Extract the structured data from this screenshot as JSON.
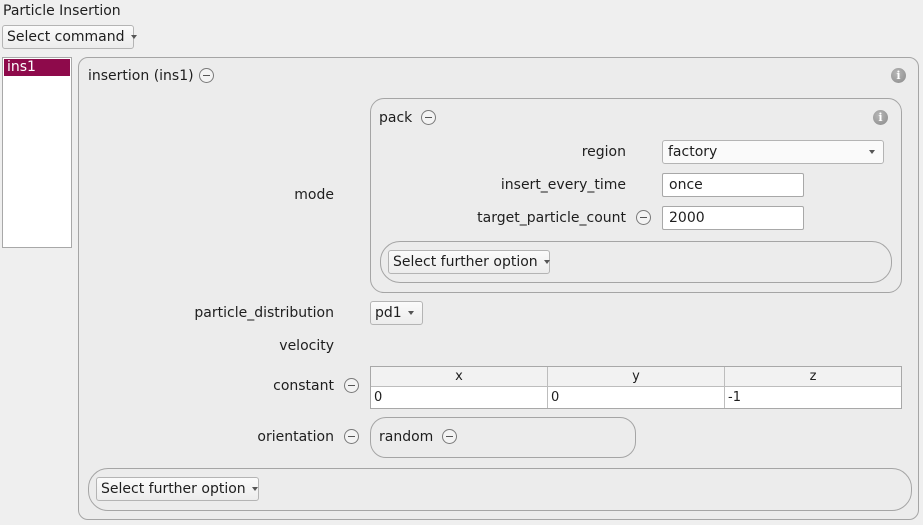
{
  "title": "Particle Insertion",
  "command_select": {
    "label": "Select command"
  },
  "command_list": {
    "items": [
      "ins1"
    ],
    "selected": "ins1"
  },
  "insertion": {
    "header": "insertion (ins1)",
    "mode_label": "mode",
    "pack": {
      "header": "pack",
      "region": {
        "label": "region",
        "value": "factory"
      },
      "insert_every_time": {
        "label": "insert_every_time",
        "value": "once"
      },
      "target_particle_count": {
        "label": "target_particle_count",
        "value": "2000"
      },
      "further_option": "Select further option"
    },
    "particle_distribution": {
      "label": "particle_distribution",
      "value": "pd1"
    },
    "velocity_label": "velocity",
    "constant": {
      "label": "constant",
      "columns": [
        "x",
        "y",
        "z"
      ],
      "values": [
        "0",
        "0",
        "-1"
      ]
    },
    "orientation": {
      "label": "orientation",
      "value": "random"
    },
    "further_option": "Select further option"
  },
  "colors": {
    "selection": "#8e0a4b",
    "background": "#efefef"
  },
  "icons": [
    "minus-circle-icon",
    "info-icon",
    "dropdown-arrow-icon"
  ]
}
